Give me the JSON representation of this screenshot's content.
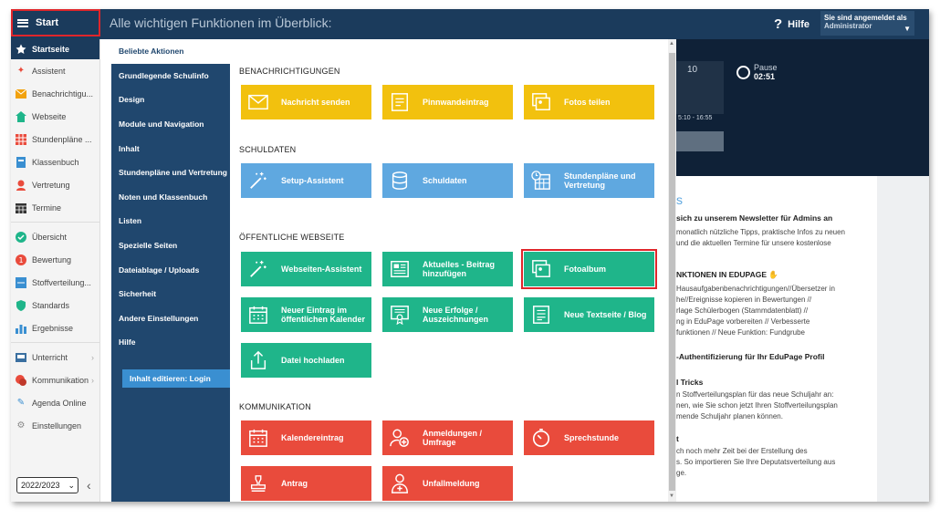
{
  "topbar": {
    "start_label": "Start",
    "title": "Alle wichtigen Funktionen im Überblick:",
    "help_label": "Hilfe",
    "login_line1": "Sie sind angemeldet als",
    "login_line2": "Administrator"
  },
  "sidebar": {
    "items": [
      {
        "label": "Startseite",
        "icon": "star-icon"
      },
      {
        "label": "Assistent",
        "icon": "wand-icon"
      },
      {
        "label": "Benachrichtigu...",
        "icon": "envelope-icon"
      },
      {
        "label": "Webseite",
        "icon": "home-icon"
      },
      {
        "label": "Stundenpläne ...",
        "icon": "timetable-icon"
      },
      {
        "label": "Klassenbuch",
        "icon": "book-icon"
      },
      {
        "label": "Vertretung",
        "icon": "person-icon"
      },
      {
        "label": "Termine",
        "icon": "calendar-icon"
      },
      {
        "label": "Übersicht",
        "icon": "check-icon"
      },
      {
        "label": "Bewertung",
        "icon": "grade-icon"
      },
      {
        "label": "Stoffverteilung...",
        "icon": "plan-icon"
      },
      {
        "label": "Standards",
        "icon": "shield-icon"
      },
      {
        "label": "Ergebnisse",
        "icon": "barchart-icon"
      },
      {
        "label": "Unterricht",
        "icon": "classroom-icon"
      },
      {
        "label": "Kommunikation",
        "icon": "chat-icon"
      },
      {
        "label": "Agenda Online",
        "icon": "pen-icon"
      },
      {
        "label": "Einstellungen",
        "icon": "gear-icon"
      }
    ],
    "year": "2022/2023"
  },
  "menu": {
    "items": [
      "Beliebte Aktionen",
      "Grundlegende Schulinfo",
      "Design",
      "Module und Navigation",
      "Inhalt",
      "Stundenpläne und Vertretung",
      "Noten und Klassenbuch",
      "Listen",
      "Spezielle Seiten",
      "Dateiablage / Uploads",
      "Sicherheit",
      "Andere Einstellungen",
      "Hilfe"
    ],
    "edit_label": "Inhalt editieren: Login"
  },
  "sections": {
    "s1": "BENACHRICHTIGUNGEN",
    "s2": "SCHULDATEN",
    "s3": "ÖFFENTLICHE WEBSEITE",
    "s4": "KOMMUNIKATION"
  },
  "tiles": {
    "nachricht": "Nachricht senden",
    "pinnwand": "Pinnwandeintrag",
    "fotos": "Fotos teilen",
    "setup": "Setup-Assistent",
    "schuldaten": "Schuldaten",
    "stundenplaene": "Stundenpläne und Vertretung",
    "webseiten": "Webseiten-Assistent",
    "aktuelles": "Aktuelles - Beitrag hinzufügen",
    "fotoalbum": "Fotoalbum",
    "kalender": "Neuer Eintrag im öffentlichen Kalender",
    "erfolge": "Neue Erfolge / Auszeichnungen",
    "textseite": "Neue Textseite / Blog",
    "datei": "Datei hochladen",
    "kalendereintrag": "Kalendereintrag",
    "anmeldungen": "Anmeldungen / Umfrage",
    "sprechstunde": "Sprechstunde",
    "antrag": "Antrag",
    "unfall": "Unfallmeldung"
  },
  "background": {
    "num": "10",
    "time": "5:10 - 16:55",
    "pause_label": "Pause",
    "pause_time": "02:51",
    "news_heading": "sich zu unserem Newsletter für Admins an",
    "news_l1": "monatlich nützliche Tipps, praktische Infos zu neuen",
    "news_l2": "und die aktuellen Termine für unsere kostenlose",
    "func_heading": "NKTIONEN IN EDUPAGE",
    "func_l1": "Hausaufgabenbenachrichtigungen//Übersetzer in",
    "func_l2": "he//Ereignisse kopieren in Bewertungen //",
    "func_l3": "rlage Schülerbogen (Stammdatenblatt) //",
    "func_l4": "ng in EduPage vorbereiten // Verbesserte",
    "func_l5": "funktionen // Neue Funktion: Fundgrube",
    "auth_heading": "-Authentifizierung für Ihr EduPage Profil",
    "tricks_heading": "l Tricks",
    "tricks_l1": "n Stoffverteilungsplan für das neue Schuljahr an:",
    "tricks_l2": "nen, wie Sie schon jetzt Ihren Stoffverteilungsplan",
    "tricks_l3": "mende Schuljahr planen können.",
    "t_heading": "t",
    "t_l1": "ch noch mehr Zeit bei der Erstellung des",
    "t_l2": "s. So importieren Sie Ihre Deputatsverteilung aus",
    "t_l3": "ge."
  },
  "colors": {
    "topbar": "#1b3b5c",
    "menu": "#20476e",
    "yellow": "#f2c10e",
    "blue": "#5fa8e0",
    "green": "#1fb58a",
    "red": "#e94b3c",
    "highlight": "#e0262b"
  }
}
